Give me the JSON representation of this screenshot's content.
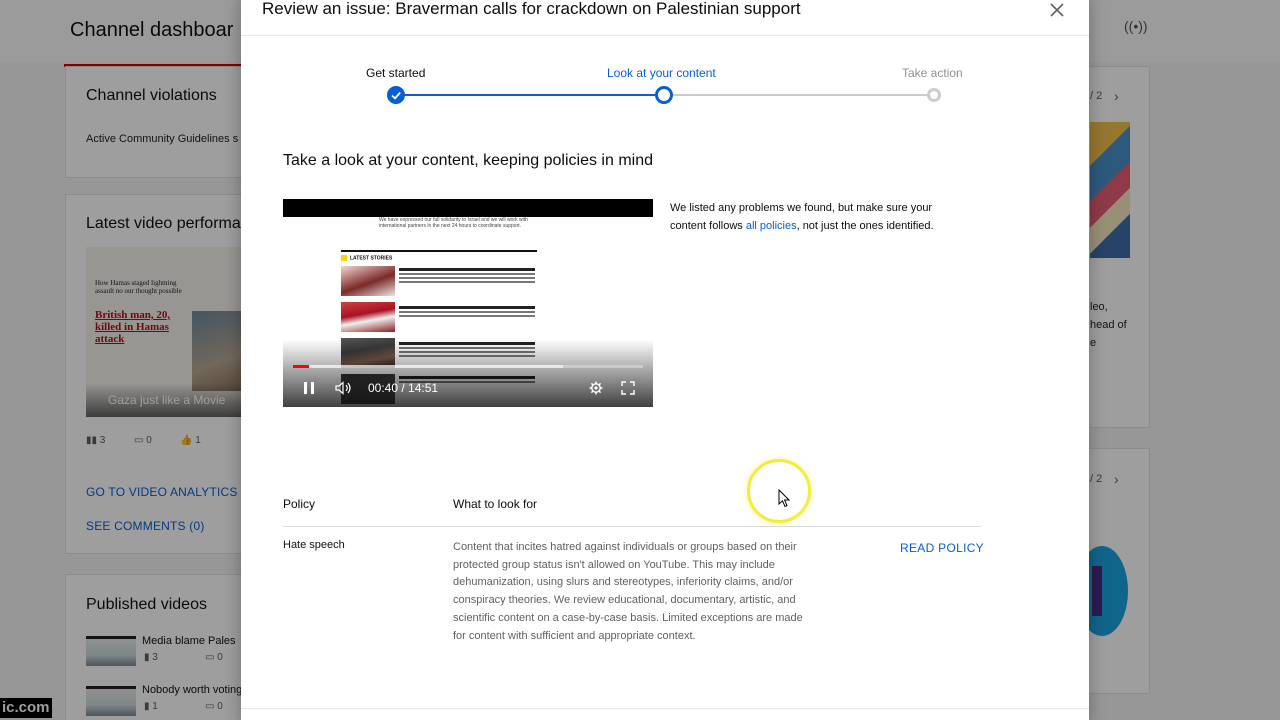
{
  "background": {
    "dashboard_title": "Channel dashboar",
    "violations": {
      "title": "Channel violations",
      "text": "Active Community Guidelines s"
    },
    "latest_video": {
      "title": "Latest video performa",
      "thumb_headline_small": "How Hamas staged lightning assault no our thought possible",
      "thumb_headline_red": "British man, 20, killed in Hamas attack",
      "thumb_caption": "Gaza just like a Movie",
      "views": "3",
      "comments": "0",
      "likes": "1",
      "analytics_link": "GO TO VIDEO ANALYTICS",
      "comments_link": "SEE COMMENTS (0)"
    },
    "published": {
      "title": "Published videos",
      "items": [
        {
          "title": "Media blame Pales",
          "views": "3",
          "comments": "0"
        },
        {
          "title": "Nobody worth voting",
          "views": "1",
          "comments": "0"
        }
      ]
    },
    "right_col": {
      "pager_top": "/ 2",
      "pager_bottom": "/ 2",
      "text_line1": "leo,",
      "text_line2": "head of",
      "text_line3": "e"
    },
    "watermark": "ic.com"
  },
  "dialog": {
    "title": "Review an issue: Braverman calls for crackdown on Palestinian support",
    "close_icon": "close-icon",
    "steps": [
      {
        "label": "Get started",
        "state": "done"
      },
      {
        "label": "Look at your content",
        "state": "current"
      },
      {
        "label": "Take action",
        "state": "upcoming"
      }
    ],
    "section_heading": "Take a look at your content, keeping policies in mind",
    "player": {
      "current_time": "00:40",
      "duration": "14:51",
      "progress_fraction": 0.045,
      "buffered_fraction": 0.77,
      "frame_top_text": "We have expressed our full solidarity to Israel and we will work with international partners in the next 24 hours to coordinate support.",
      "latest_label": "LATEST STORIES"
    },
    "note": {
      "before": "We listed any problems we found, but make sure your content follows ",
      "link": "all policies",
      "after": ", not just the ones identified."
    },
    "table": {
      "col_policy": "Policy",
      "col_what": "What to look for",
      "rows": [
        {
          "policy": "Hate speech",
          "description": "Content that incites hatred against individuals or groups based on their protected group status isn't allowed on YouTube. This may include dehumanization, using slurs and stereotypes, inferiority claims, and/or conspiracy theories. We review educational, documentary, artistic, and scientific content on a case-by-case basis. Limited exceptions are made for content with sufficient and appropriate context.",
          "action": "READ POLICY"
        }
      ]
    }
  },
  "colors": {
    "accent_blue": "#065fd4",
    "stepper_active": "#065fd4",
    "stepper_inactive": "#cccccc",
    "progress_red": "#ff0000",
    "cursor_highlight": "#f2ec3a"
  }
}
